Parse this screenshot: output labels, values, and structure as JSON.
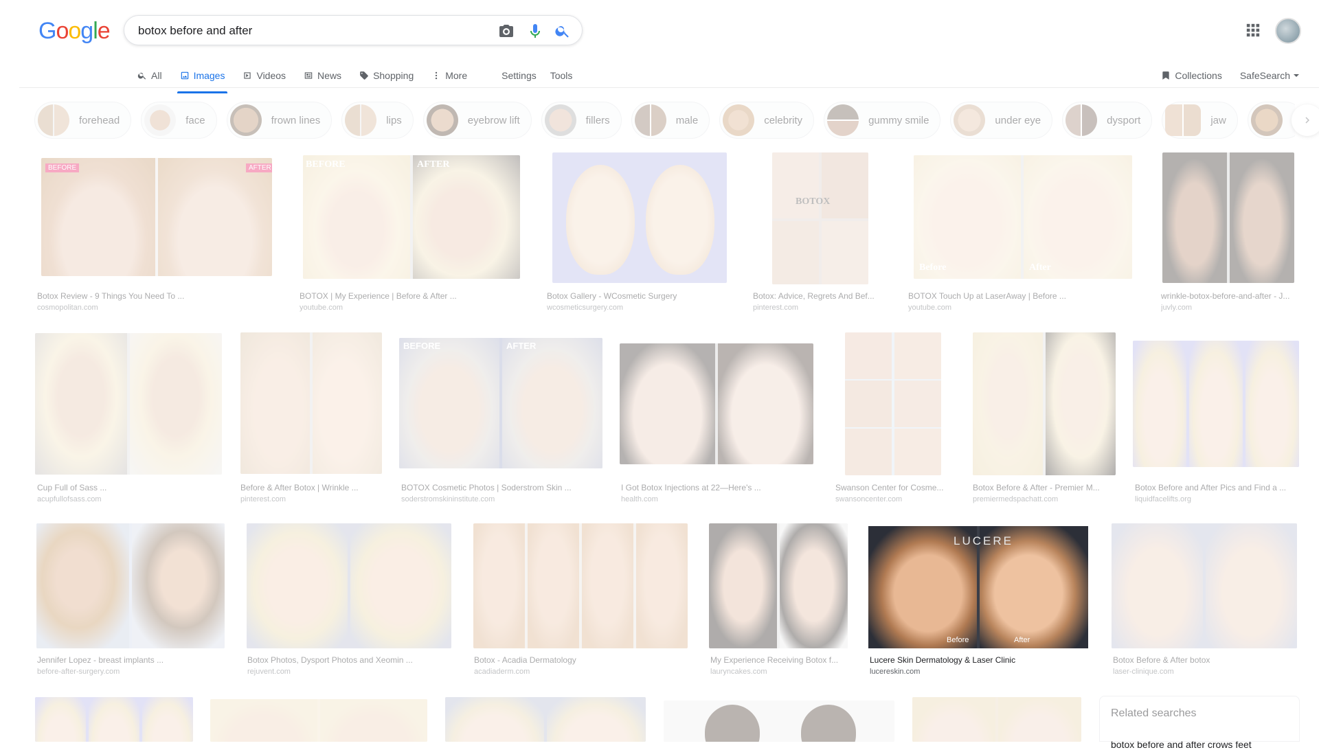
{
  "logo": {
    "letters": [
      "G",
      "o",
      "o",
      "g",
      "l",
      "e"
    ]
  },
  "search": {
    "query": "botox before and after",
    "icons": [
      "camera-icon",
      "microphone-icon",
      "search-icon"
    ]
  },
  "tabs": [
    {
      "label": "All",
      "icon": "search-icon"
    },
    {
      "label": "Images",
      "icon": "image-icon",
      "active": true
    },
    {
      "label": "Videos",
      "icon": "video-icon"
    },
    {
      "label": "News",
      "icon": "news-icon"
    },
    {
      "label": "Shopping",
      "icon": "tag-icon"
    },
    {
      "label": "More",
      "icon": "more-vert-icon"
    }
  ],
  "tools": {
    "settings": "Settings",
    "tools": "Tools"
  },
  "header_right": {
    "collections": "Collections",
    "safesearch": "SafeSearch"
  },
  "chips": [
    "forehead",
    "face",
    "frown lines",
    "lips",
    "eyebrow lift",
    "fillers",
    "male",
    "celebrity",
    "gummy smile",
    "under eye",
    "dysport",
    "jaw"
  ],
  "results": [
    {
      "caption": "Botox Review - 9 Things You Need To ...",
      "source": "cosmopolitan.com"
    },
    {
      "caption": "BOTOX | My Experience | Before & After ...",
      "source": "youtube.com"
    },
    {
      "caption": "Botox Gallery - WCosmetic Surgery",
      "source": "wcosmeticsurgery.com"
    },
    {
      "caption": "Botox: Advice, Regrets And Bef...",
      "source": "pinterest.com"
    },
    {
      "caption": "BOTOX Touch Up at LaserAway | Before ...",
      "source": "youtube.com"
    },
    {
      "caption": "wrinkle-botox-before-and-after - J...",
      "source": "juvly.com"
    },
    {
      "caption": "Cup Full of Sass ...",
      "source": "acupfullofsass.com"
    },
    {
      "caption": "Before & After Botox | Wrinkle ...",
      "source": "pinterest.com"
    },
    {
      "caption": "BOTOX Cosmetic Photos | Soderstrom Skin ...",
      "source": "soderstromskininstitute.com"
    },
    {
      "caption": "I Got Botox Injections at 22—Here's ...",
      "source": "health.com"
    },
    {
      "caption": "Swanson Center for Cosme...",
      "source": "swansoncenter.com"
    },
    {
      "caption": "Botox Before & After - Premier M...",
      "source": "premiermedspachatt.com"
    },
    {
      "caption": "Botox Before and After Pics and Find a ...",
      "source": "liquidfacelifts.org"
    },
    {
      "caption": "Jennifer Lopez - breast implants ...",
      "source": "before-after-surgery.com"
    },
    {
      "caption": "Botox Photos, Dysport Photos and Xeomin ...",
      "source": "rejuvent.com"
    },
    {
      "caption": "Botox - Acadia Dermatology",
      "source": "acadiaderm.com"
    },
    {
      "caption": "My Experience Receiving Botox f...",
      "source": "lauryncakes.com"
    },
    {
      "caption": "Lucere Skin Dermatology & Laser Clinic",
      "source": "lucereskin.com"
    },
    {
      "caption": "Botox Before & After botox",
      "source": "laser-clinique.com"
    }
  ],
  "image_labels": {
    "before_caps": "BEFORE",
    "after_caps": "AFTER",
    "before": "Before",
    "after": "After",
    "botox": "BOTOX",
    "lucere": "LUCERE"
  },
  "related": {
    "title": "Related searches",
    "first": "botox before and after crows feet"
  }
}
